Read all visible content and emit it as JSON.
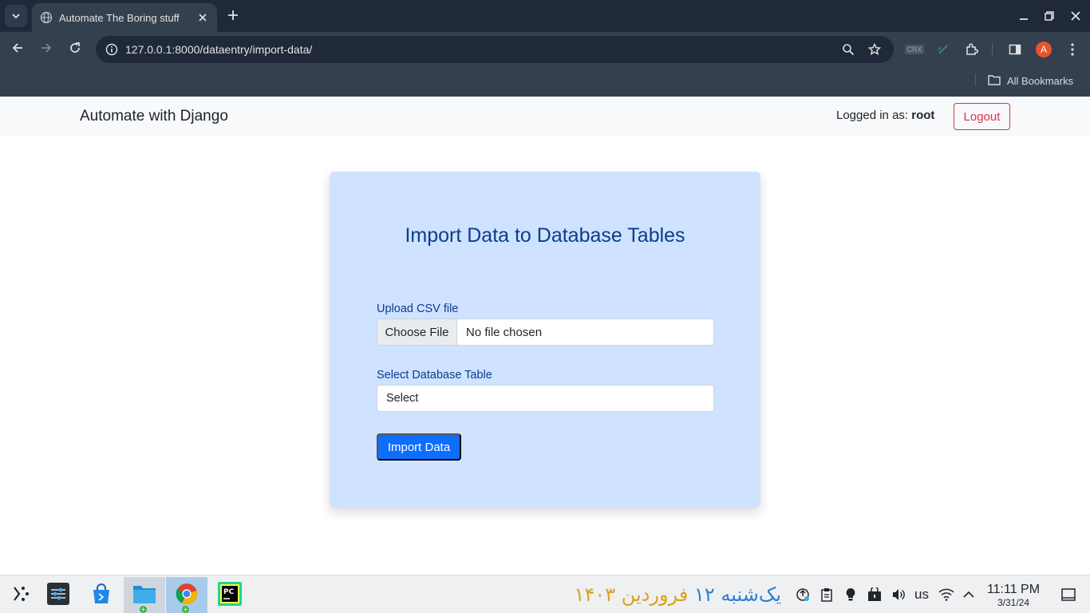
{
  "browser": {
    "tab_title": "Automate The Boring stuff",
    "url": "127.0.0.1:8000/dataentry/import-data/",
    "bookmarks_label": "All Bookmarks",
    "profile_initial": "A",
    "crx_label": "CRX"
  },
  "navbar": {
    "brand": "Automate with Django",
    "logged_in_prefix": "Logged in as: ",
    "username": "root",
    "logout_label": "Logout"
  },
  "form": {
    "title": "Import Data to Database Tables",
    "upload_label": "Upload CSV file",
    "choose_file_label": "Choose File",
    "file_status": "No file chosen",
    "table_label": "Select Database Table",
    "table_selected": "Select",
    "submit_label": "Import Data"
  },
  "taskbar": {
    "date_weekday_day": "یک‌شنبه ۱۲",
    "date_month_year": "فروردین ۱۴۰۳",
    "keyboard_layout": "us",
    "clock_time": "11:11 PM",
    "clock_date": "3/31/24",
    "launcher_badge": "+"
  },
  "colors": {
    "chrome_dark": "#1f2939",
    "chrome_toolbar": "#35404f",
    "card_bg": "#cfe2ff",
    "card_text": "#0a3d8f",
    "primary": "#0d6efd",
    "danger": "#dc3545",
    "persian_blue": "#2a7fd4",
    "persian_gold": "#d8a21a"
  }
}
